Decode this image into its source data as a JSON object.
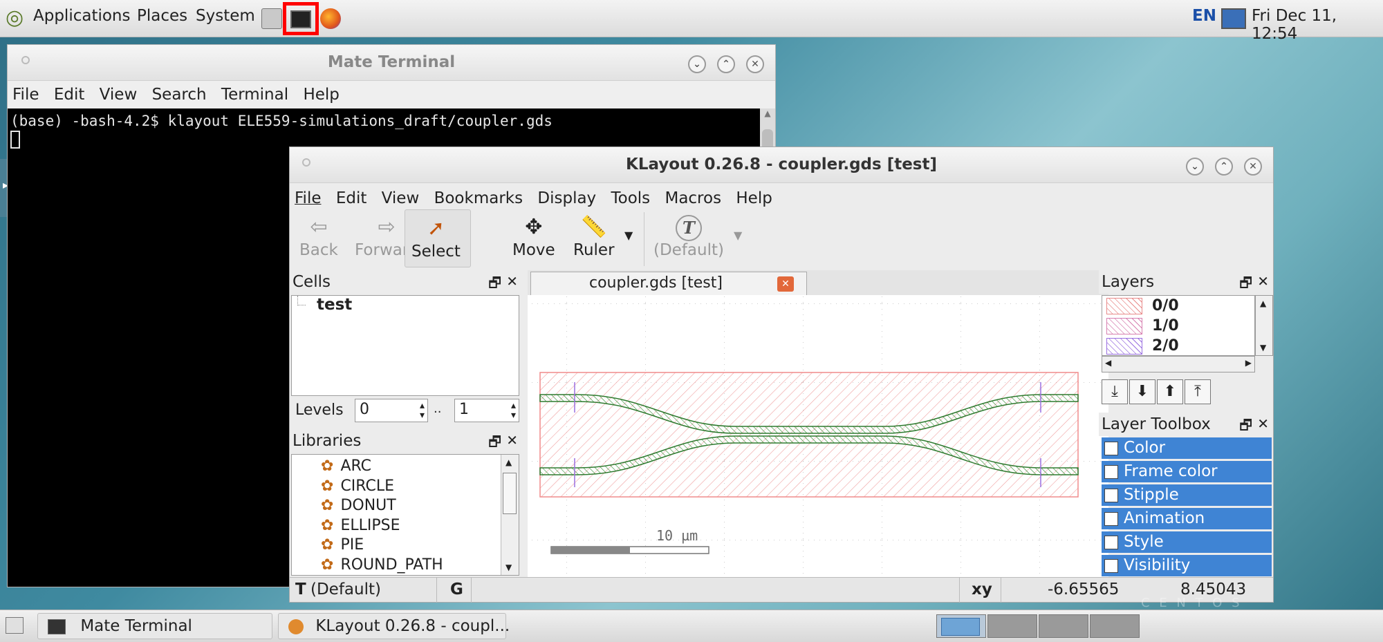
{
  "top_panel": {
    "menus": [
      "Applications",
      "Places",
      "System"
    ],
    "keyboard_layout": "EN",
    "clock": "Fri Dec 11, 12:54"
  },
  "terminal": {
    "title": "Mate Terminal",
    "menu": [
      "File",
      "Edit",
      "View",
      "Search",
      "Terminal",
      "Help"
    ],
    "line1": "(base) -bash-4.2$ klayout ELE559-simulations_draft/coupler.gds"
  },
  "klayout": {
    "title": "KLayout 0.26.8 - coupler.gds [test]",
    "menu": [
      "File",
      "Edit",
      "View",
      "Bookmarks",
      "Display",
      "Tools",
      "Macros",
      "Help"
    ],
    "toolbar": {
      "back": "Back",
      "forward": "Forward",
      "select": "Select",
      "move": "Move",
      "ruler": "Ruler",
      "default": "(Default)"
    },
    "cells": {
      "title": "Cells",
      "tree_item": "test"
    },
    "levels": {
      "label": "Levels",
      "from": "0",
      "sep": "..",
      "to": "1"
    },
    "libraries": {
      "title": "Libraries",
      "items": [
        "ARC",
        "CIRCLE",
        "DONUT",
        "ELLIPSE",
        "PIE",
        "ROUND_PATH"
      ]
    },
    "tab": {
      "label": "coupler.gds [test]"
    },
    "canvas": {
      "scale_label": "10 µm"
    },
    "layers": {
      "title": "Layers",
      "items": [
        "0/0",
        "1/0",
        "2/0"
      ],
      "colors": [
        "#e88a8a",
        "#d77fb0",
        "#9a6fe0"
      ]
    },
    "layer_toolbox": {
      "title": "Layer Toolbox",
      "items": [
        "Color",
        "Frame color",
        "Stipple",
        "Animation",
        "Style",
        "Visibility"
      ]
    },
    "status": {
      "mode_icon": "T",
      "mode": "(Default)",
      "g": "G",
      "xy_label": "xy",
      "x": "-6.65565",
      "y": "8.45043"
    }
  },
  "taskbar": {
    "items": [
      "Mate Terminal",
      "KLayout 0.26.8 - coupl..."
    ]
  },
  "watermark": "C E N T O S",
  "colors": {
    "layer_red": "#e05050",
    "waveguide_green": "#2e8a2e",
    "selection_blue": "#3f84d4",
    "highlight_red": "#ff0000"
  }
}
